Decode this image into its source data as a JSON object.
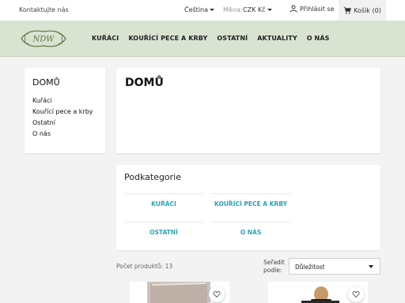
{
  "topbar": {
    "contact": "Kontaktujte nás",
    "language": "Čeština",
    "currency_label": "Měna:",
    "currency_value": "CZK Kč",
    "login": "Přihlásit se",
    "cart": "Košík (0)"
  },
  "logo": {
    "text": "NDW"
  },
  "menu": {
    "items": [
      "KUŘÁCI",
      "KOUŘÍCÍ PECE A KRBY",
      "OSTATNÍ",
      "AKTUALITY",
      "O NÁS"
    ]
  },
  "sidebar": {
    "title": "DOMŮ",
    "items": [
      "Kuřáci",
      "Kouřící pece a krby",
      "Ostatní",
      "O nás"
    ]
  },
  "main": {
    "heading": "DOMŮ",
    "subcategories_title": "Podkategorie",
    "subcategories": [
      "KUŘÁCI",
      "KOUŘÍCÍ PECE A KRBY",
      "OSTATNÍ",
      "O NÁS"
    ],
    "product_count": "Počet produktů: 13",
    "sort_label_line1": "Seřadit",
    "sort_label_line2": "podle:",
    "sort_value": "Důležitost"
  },
  "colors": {
    "accent": "#29a5b6",
    "navbar_bg": "#d9e3d2",
    "logo_green": "#5b7a3e"
  },
  "icons": {
    "login": "person-icon",
    "cart": "shopping-cart-icon",
    "favorite": "heart-outline-icon",
    "dropdown": "caret-down-icon"
  }
}
